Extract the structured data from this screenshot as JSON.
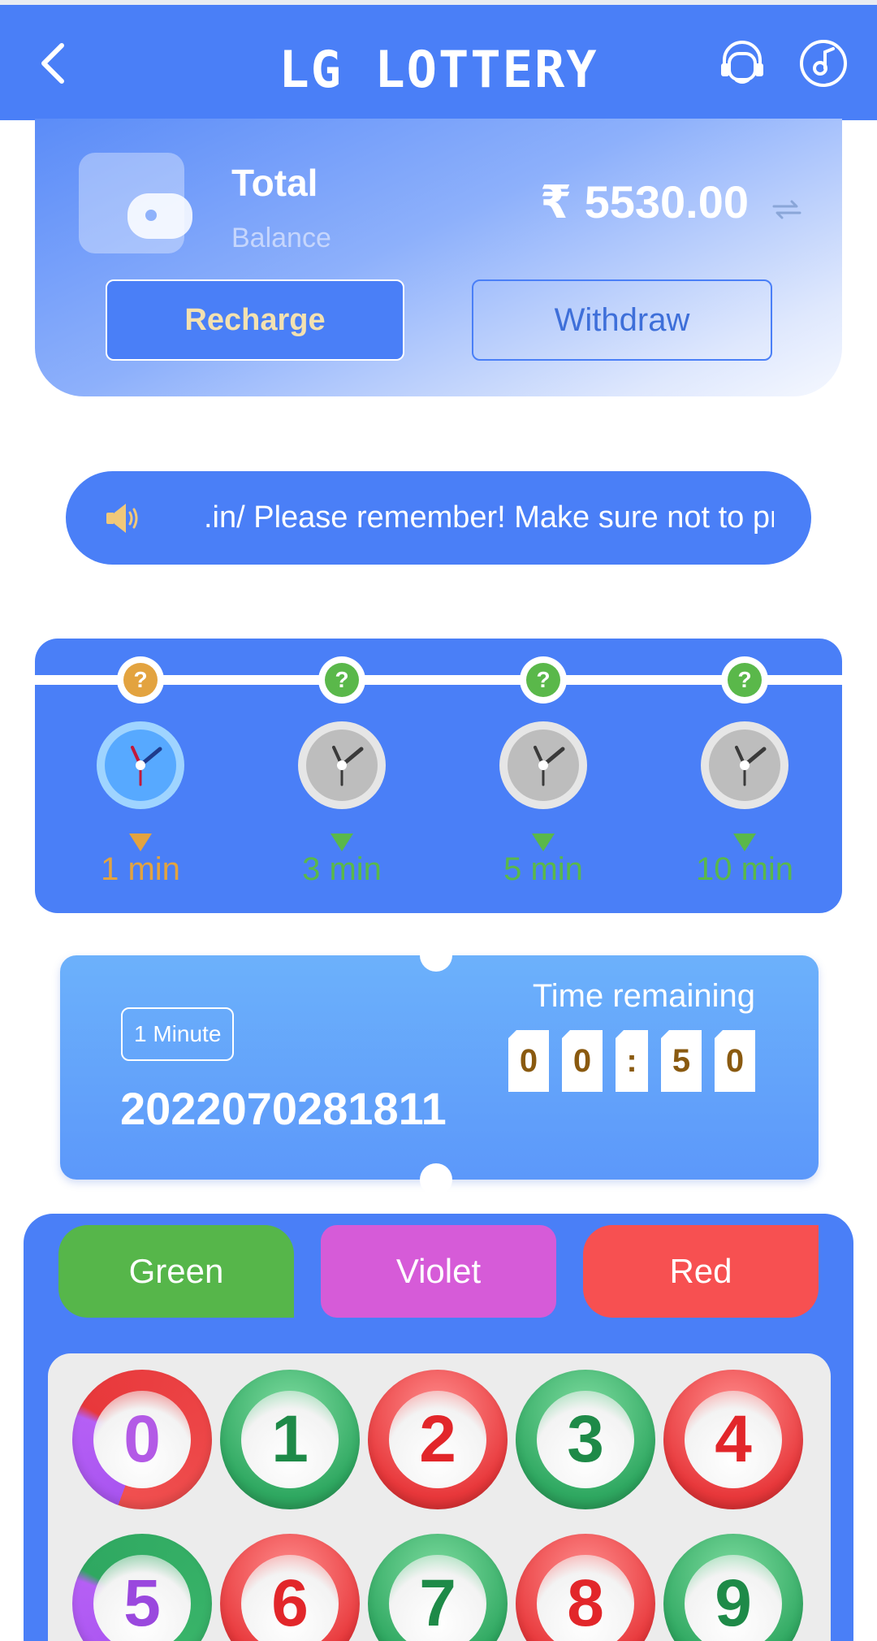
{
  "header": {
    "title": "LG LOTTERY",
    "icons": [
      "back-icon",
      "support-icon",
      "music-icon"
    ]
  },
  "wallet": {
    "total_label": "Total",
    "balance_label": "Balance",
    "amount": "₹ 5530.00",
    "recharge_label": "Recharge",
    "withdraw_label": "Withdraw"
  },
  "notice": {
    "text": ".in/ Please remember! Make sure not to pro"
  },
  "periods": [
    {
      "label": "1 min",
      "active": true
    },
    {
      "label": "3 min",
      "active": false
    },
    {
      "label": "5 min",
      "active": false
    },
    {
      "label": "10 min",
      "active": false
    }
  ],
  "timer": {
    "mode_tag": "1 Minute",
    "period_number": "2022070281811",
    "time_label": "Time remaining",
    "digits": [
      "0",
      "0",
      ":",
      "5",
      "0"
    ]
  },
  "bet": {
    "colors": [
      {
        "label": "Green",
        "hex": "#56b64a"
      },
      {
        "label": "Violet",
        "hex": "#d65bd8"
      },
      {
        "label": "Red",
        "hex": "#f75051"
      }
    ],
    "numbers": [
      "0",
      "1",
      "2",
      "3",
      "4",
      "5",
      "6",
      "7",
      "8",
      "9"
    ]
  },
  "colors": {
    "primary": "#4a7ff7",
    "active_accent": "#e3a33f",
    "inactive_accent": "#5ab84a"
  }
}
